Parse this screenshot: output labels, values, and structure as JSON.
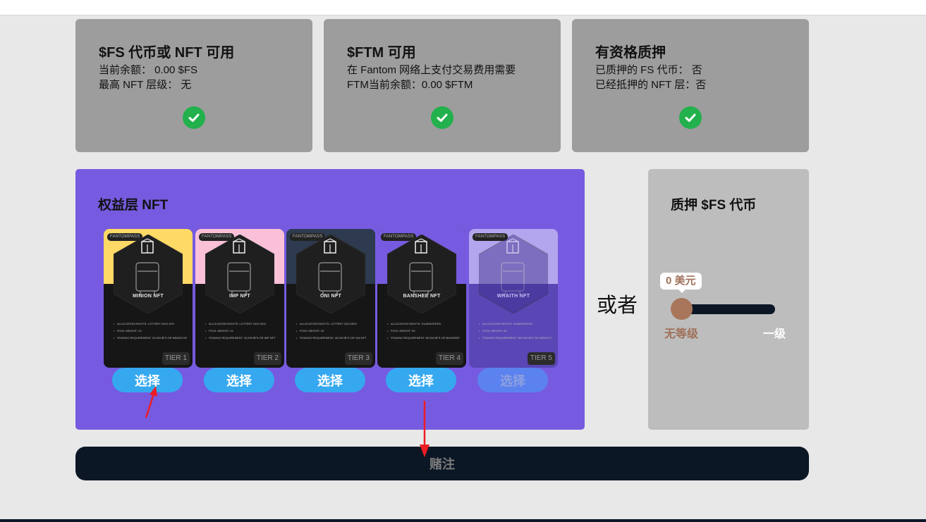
{
  "requirements": [
    {
      "title": "$FS 代币或 NFT 可用",
      "line1": "当前余额： 0.00 $FS",
      "line2": "最高 NFT 层级： 无"
    },
    {
      "title": "$FTM 可用",
      "line1": "在 Fantom 网络上支付交易费用需要",
      "line2": "FTM当前余额：0.00 $FTM"
    },
    {
      "title": "有资格质押",
      "line1": "已质押的 FS 代币： 否",
      "line2": "已经抵押的 NFT 层：否"
    }
  ],
  "nft_panel": {
    "title": "权益层 NFT",
    "cards": [
      {
        "badge": "FANTOMPASS",
        "name": "MINION NFT",
        "tier": "TIER 1",
        "top_color": "#ffd966",
        "select": "选择",
        "disabled": false,
        "lines": [
          "ALLOCATION RIGHTS: LOTTERY 2023 10%",
          "POOL WEIGHT: 1X",
          "STAKING REQUIREMENT: 10,000 $FS OR MINION NFT"
        ]
      },
      {
        "badge": "FANTOMPASS",
        "name": "IMP NFT",
        "tier": "TIER 2",
        "top_color": "#f9c0d8",
        "select": "选择",
        "disabled": false,
        "lines": [
          "ALLOCATION RIGHTS: LOTTERY 2023 40%",
          "POOL WEIGHT: 1X",
          "STAKING REQUIREMENT: 20,000 $FS OR IMP NFT"
        ]
      },
      {
        "badge": "FANTOMPASS",
        "name": "ONI NFT",
        "tier": "TIER 3",
        "top_color": "#2d3a4f",
        "select": "选择",
        "disabled": false,
        "lines": [
          "ALLOCATION RIGHTS: LOTTERY 2023 80%",
          "POOL WEIGHT: 3X",
          "STAKING REQUIREMENT: 40,000 $FS OR ONI NFT"
        ]
      },
      {
        "badge": "FANTOMPASS",
        "name": "BANSHEE NFT",
        "tier": "TIER 4",
        "top_color": "#765be0",
        "select": "选择",
        "disabled": false,
        "lines": [
          "ALLOCATION RIGHTS: GUARANTEED",
          "POOL WEIGHT: 5X",
          "STAKING REQUIREMENT: 80,000 $FS OR BANSHEE NFT"
        ]
      },
      {
        "badge": "FANTOMPASS",
        "name": "WRAITH NFT",
        "tier": "TIER 5",
        "top_color": "#b4a6ee",
        "select": "选择",
        "disabled": true,
        "lines": [
          "ALLOCATION RIGHTS: GUARANTEED",
          "POOL WEIGHT: 8X",
          "STAKING REQUIREMENT: 160,000 $FS OR WRAITH NFT"
        ]
      }
    ]
  },
  "or_label": "或者",
  "stake_panel": {
    "title": "质押 $FS 代币",
    "bubble": "0 美元",
    "slider_value": 0,
    "tick_left": "无等级",
    "tick_right": "一级"
  },
  "stake_button": "赌注",
  "colors": {
    "panel_purple": "#765be0",
    "check_green": "#22b14c",
    "button_blue": "#35a8f0",
    "navy": "#0c1726",
    "arrow_red": "#ee1c24"
  }
}
